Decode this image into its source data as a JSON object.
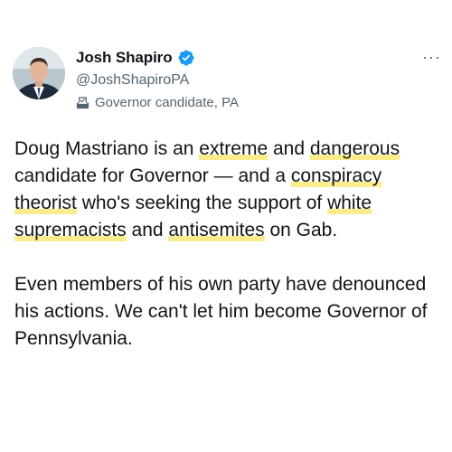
{
  "author": {
    "display_name": "Josh Shapiro",
    "handle": "@JoshShapiroPA",
    "label": "Governor candidate, PA",
    "label_icon": "ballot-box-icon",
    "verified": true,
    "verified_color": "#1d9bf0"
  },
  "menu": {
    "more_icon": "···"
  },
  "tweet": {
    "paragraph1": [
      {
        "text": "Doug Mastriano is an ",
        "highlight": false
      },
      {
        "text": "extreme",
        "highlight": true
      },
      {
        "text": " and ",
        "highlight": false
      },
      {
        "text": "dangerous",
        "highlight": true
      },
      {
        "text": " candidate for Governor — and a ",
        "highlight": false
      },
      {
        "text": "conspiracy theorist",
        "highlight": true
      },
      {
        "text": "  who's seeking the support of ",
        "highlight": false
      },
      {
        "text": "white supremacists",
        "highlight": true
      },
      {
        "text": " and ",
        "highlight": false
      },
      {
        "text": "antisemites",
        "highlight": true
      },
      {
        "text": " on Gab.",
        "highlight": false
      }
    ],
    "paragraph2": "Even members of his own party have denounced his actions. We can't let him become Governor of Pennsylvania.",
    "highlight_color": "#fae878"
  }
}
